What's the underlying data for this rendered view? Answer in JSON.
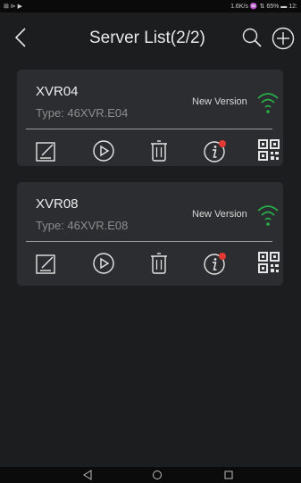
{
  "status_bar": {
    "left_icons": "⊞ ⊳ ▶",
    "right_text": "1.6K/s ♒ ⇅ 65% ▬ 12:"
  },
  "header": {
    "title": "Server List(2/2)"
  },
  "servers": [
    {
      "name": "XVR04",
      "type": "Type: 46XVR.E04",
      "version_label": "New Version",
      "signal_color": "#27b24a",
      "notification_color": "#e53935"
    },
    {
      "name": "XVR08",
      "type": "Type: 46XVR.E08",
      "version_label": "New Version",
      "signal_color": "#27b24a",
      "notification_color": "#e53935"
    }
  ],
  "icons": {
    "back": "chevron-left-icon",
    "search": "search-icon",
    "add": "plus-circle-icon",
    "edit": "edit-icon",
    "play": "play-icon",
    "delete": "trash-icon",
    "info": "info-icon",
    "qr": "qr-code-icon",
    "wifi": "wifi-icon",
    "nav_back": "triangle-back-icon",
    "nav_home": "circle-home-icon",
    "nav_recent": "square-recent-icon"
  },
  "colors": {
    "background": "#1c1d1f",
    "card": "#2c2d30",
    "accent_green": "#27b24a"
  }
}
